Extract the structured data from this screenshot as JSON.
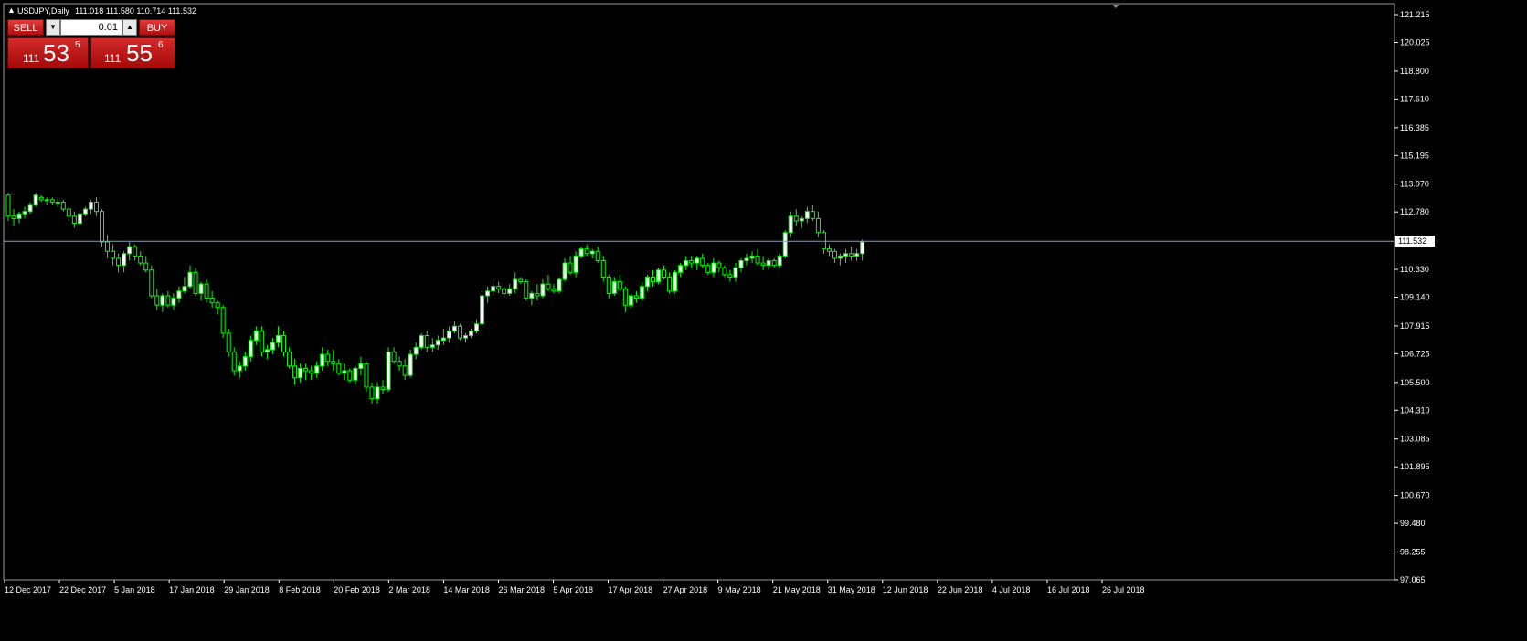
{
  "header": {
    "symbol": "USDJPY,Daily",
    "ohlc": "111.018 111.580 110.714 111.532"
  },
  "trade_panel": {
    "sell_label": "SELL",
    "buy_label": "BUY",
    "lot_value": "0.01",
    "sell_price": {
      "small": "111",
      "big": "53",
      "sup": "5"
    },
    "buy_price": {
      "small": "111",
      "big": "55",
      "sup": "6"
    }
  },
  "colors": {
    "background": "#000000",
    "axis": "#ffffff",
    "bull_fill": "#ffffff",
    "bull_wick": "#00ff00",
    "bear_fill": "#000000",
    "current_price_line": "#8aa0b8"
  },
  "chart_data": {
    "type": "candlestick",
    "ylim": [
      97.065,
      121.215
    ],
    "y_ticks": [
      "121.215",
      "120.025",
      "118.800",
      "117.610",
      "116.385",
      "115.195",
      "113.970",
      "112.780",
      "110.330",
      "109.140",
      "107.915",
      "106.725",
      "105.500",
      "104.310",
      "103.085",
      "101.895",
      "100.670",
      "99.480",
      "98.255",
      "97.065"
    ],
    "current_price": "111.532",
    "x_tick_labels": [
      "12 Dec 2017",
      "22 Dec 2017",
      "5 Jan 2018",
      "17 Jan 2018",
      "29 Jan 2018",
      "8 Feb 2018",
      "20 Feb 2018",
      "2 Mar 2018",
      "14 Mar 2018",
      "26 Mar 2018",
      "5 Apr 2018",
      "17 Apr 2018",
      "27 Apr 2018",
      "9 May 2018",
      "21 May 2018",
      "31 May 2018",
      "12 Jun 2018",
      "22 Jun 2018",
      "4 Jul 2018",
      "16 Jul 2018",
      "26 Jul 2018"
    ],
    "candles": [
      [
        113.5,
        113.6,
        112.4,
        112.6
      ],
      [
        112.6,
        112.9,
        112.2,
        112.5
      ],
      [
        112.5,
        112.8,
        112.3,
        112.7
      ],
      [
        112.7,
        113.0,
        112.5,
        112.8
      ],
      [
        112.8,
        113.2,
        112.7,
        113.1
      ],
      [
        113.1,
        113.6,
        113.0,
        113.5
      ],
      [
        113.4,
        113.5,
        113.2,
        113.3
      ],
      [
        113.3,
        113.4,
        113.1,
        113.3
      ],
      [
        113.3,
        113.4,
        113.1,
        113.2
      ],
      [
        113.2,
        113.4,
        113.0,
        113.2
      ],
      [
        113.2,
        113.3,
        112.8,
        112.9
      ],
      [
        112.9,
        113.0,
        112.4,
        112.6
      ],
      [
        112.6,
        112.8,
        112.1,
        112.3
      ],
      [
        112.3,
        112.8,
        112.2,
        112.7
      ],
      [
        112.7,
        113.0,
        112.6,
        112.9
      ],
      [
        112.9,
        113.3,
        112.7,
        113.2
      ],
      [
        113.2,
        113.4,
        112.6,
        112.8
      ],
      [
        112.8,
        112.9,
        111.3,
        111.5
      ],
      [
        111.5,
        111.8,
        110.8,
        111.1
      ],
      [
        111.1,
        111.4,
        110.5,
        110.8
      ],
      [
        110.8,
        111.0,
        110.2,
        110.5
      ],
      [
        110.5,
        111.1,
        110.2,
        111.0
      ],
      [
        111.0,
        111.5,
        110.7,
        111.3
      ],
      [
        111.3,
        111.4,
        110.7,
        110.9
      ],
      [
        110.9,
        111.1,
        110.5,
        110.6
      ],
      [
        110.6,
        110.9,
        110.2,
        110.3
      ],
      [
        110.3,
        110.5,
        109.1,
        109.2
      ],
      [
        109.2,
        109.5,
        108.6,
        108.8
      ],
      [
        108.8,
        109.3,
        108.5,
        109.2
      ],
      [
        109.2,
        109.4,
        108.7,
        108.8
      ],
      [
        108.8,
        109.3,
        108.6,
        109.1
      ],
      [
        109.1,
        109.6,
        108.9,
        109.4
      ],
      [
        109.4,
        110.0,
        109.3,
        109.6
      ],
      [
        109.6,
        110.5,
        109.5,
        110.2
      ],
      [
        110.2,
        110.4,
        109.2,
        109.3
      ],
      [
        109.3,
        109.8,
        109.0,
        109.7
      ],
      [
        109.7,
        109.9,
        108.9,
        109.1
      ],
      [
        109.1,
        109.4,
        108.7,
        108.9
      ],
      [
        108.9,
        109.0,
        108.4,
        108.7
      ],
      [
        108.7,
        108.8,
        107.4,
        107.6
      ],
      [
        107.6,
        107.8,
        106.6,
        106.8
      ],
      [
        106.8,
        107.0,
        105.8,
        106.0
      ],
      [
        106.0,
        106.4,
        105.7,
        106.2
      ],
      [
        106.2,
        106.8,
        106.0,
        106.6
      ],
      [
        106.6,
        107.5,
        106.4,
        107.3
      ],
      [
        107.3,
        107.9,
        107.1,
        107.7
      ],
      [
        107.7,
        107.9,
        106.6,
        106.8
      ],
      [
        106.8,
        107.1,
        106.5,
        106.9
      ],
      [
        106.9,
        107.4,
        106.7,
        107.2
      ],
      [
        107.2,
        107.9,
        107.0,
        107.5
      ],
      [
        107.5,
        107.7,
        106.6,
        106.8
      ],
      [
        106.8,
        107.0,
        106.1,
        106.2
      ],
      [
        106.2,
        106.5,
        105.4,
        105.7
      ],
      [
        105.7,
        106.3,
        105.5,
        106.1
      ],
      [
        106.1,
        106.3,
        105.6,
        106.0
      ],
      [
        106.0,
        106.2,
        105.6,
        105.9
      ],
      [
        105.9,
        106.4,
        105.7,
        106.2
      ],
      [
        106.2,
        107.0,
        106.0,
        106.7
      ],
      [
        106.7,
        106.9,
        106.2,
        106.4
      ],
      [
        106.4,
        106.9,
        106.0,
        106.3
      ],
      [
        106.3,
        106.5,
        105.8,
        105.9
      ],
      [
        105.9,
        106.3,
        105.6,
        106.0
      ],
      [
        106.0,
        106.1,
        105.5,
        105.6
      ],
      [
        105.6,
        106.2,
        105.4,
        106.1
      ],
      [
        106.1,
        106.6,
        105.8,
        106.3
      ],
      [
        106.3,
        106.4,
        105.1,
        105.3
      ],
      [
        105.3,
        105.5,
        104.6,
        104.8
      ],
      [
        104.8,
        105.5,
        104.6,
        105.3
      ],
      [
        105.3,
        105.6,
        105.0,
        105.2
      ],
      [
        105.2,
        107.0,
        105.1,
        106.8
      ],
      [
        106.8,
        107.0,
        106.3,
        106.4
      ],
      [
        106.4,
        106.6,
        106.0,
        106.2
      ],
      [
        106.2,
        106.5,
        105.6,
        105.8
      ],
      [
        105.8,
        106.9,
        105.7,
        106.7
      ],
      [
        106.7,
        107.2,
        106.5,
        107.0
      ],
      [
        107.0,
        107.6,
        106.9,
        107.5
      ],
      [
        107.5,
        107.7,
        106.8,
        107.0
      ],
      [
        107.0,
        107.4,
        106.8,
        107.1
      ],
      [
        107.1,
        107.5,
        106.9,
        107.3
      ],
      [
        107.3,
        107.8,
        107.1,
        107.4
      ],
      [
        107.4,
        107.9,
        107.2,
        107.7
      ],
      [
        107.7,
        108.1,
        107.6,
        107.9
      ],
      [
        107.9,
        108.0,
        107.3,
        107.4
      ],
      [
        107.4,
        107.6,
        107.2,
        107.5
      ],
      [
        107.5,
        107.8,
        107.4,
        107.7
      ],
      [
        107.7,
        108.2,
        107.6,
        108.0
      ],
      [
        108.0,
        109.4,
        107.9,
        109.2
      ],
      [
        109.2,
        109.6,
        108.9,
        109.4
      ],
      [
        109.4,
        109.9,
        109.2,
        109.6
      ],
      [
        109.6,
        109.8,
        109.3,
        109.5
      ],
      [
        109.5,
        109.6,
        109.1,
        109.3
      ],
      [
        109.3,
        109.7,
        109.2,
        109.5
      ],
      [
        109.5,
        110.2,
        109.3,
        109.9
      ],
      [
        109.9,
        110.0,
        109.7,
        109.8
      ],
      [
        109.8,
        109.9,
        109.0,
        109.1
      ],
      [
        109.1,
        109.4,
        108.8,
        109.3
      ],
      [
        109.3,
        109.7,
        109.0,
        109.2
      ],
      [
        109.2,
        109.9,
        109.1,
        109.7
      ],
      [
        109.7,
        110.1,
        109.4,
        109.5
      ],
      [
        109.5,
        109.7,
        109.3,
        109.4
      ],
      [
        109.4,
        110.0,
        109.3,
        109.9
      ],
      [
        109.9,
        110.8,
        109.8,
        110.6
      ],
      [
        110.6,
        110.9,
        110.1,
        110.2
      ],
      [
        110.2,
        111.1,
        110.0,
        110.9
      ],
      [
        110.9,
        111.3,
        110.8,
        111.2
      ],
      [
        111.2,
        111.4,
        110.9,
        111.0
      ],
      [
        111.0,
        111.2,
        110.8,
        111.1
      ],
      [
        111.1,
        111.3,
        110.6,
        110.7
      ],
      [
        110.7,
        110.9,
        109.8,
        110.0
      ],
      [
        110.0,
        110.1,
        109.1,
        109.3
      ],
      [
        109.3,
        110.0,
        109.2,
        109.8
      ],
      [
        109.8,
        110.1,
        109.4,
        109.5
      ],
      [
        109.5,
        109.6,
        108.5,
        108.8
      ],
      [
        108.8,
        109.3,
        108.7,
        109.2
      ],
      [
        109.2,
        109.4,
        108.9,
        109.1
      ],
      [
        109.1,
        109.8,
        109.0,
        109.6
      ],
      [
        109.6,
        110.1,
        109.4,
        110.0
      ],
      [
        110.0,
        110.3,
        109.6,
        109.8
      ],
      [
        109.8,
        110.4,
        109.7,
        110.3
      ],
      [
        110.3,
        110.5,
        109.9,
        110.0
      ],
      [
        110.0,
        110.2,
        109.3,
        109.4
      ],
      [
        109.4,
        110.3,
        109.3,
        110.2
      ],
      [
        110.2,
        110.6,
        110.0,
        110.5
      ],
      [
        110.5,
        110.9,
        110.3,
        110.7
      ],
      [
        110.7,
        110.9,
        110.4,
        110.6
      ],
      [
        110.6,
        110.9,
        110.3,
        110.8
      ],
      [
        110.8,
        111.0,
        110.4,
        110.5
      ],
      [
        110.5,
        110.6,
        110.1,
        110.2
      ],
      [
        110.2,
        110.8,
        110.0,
        110.6
      ],
      [
        110.6,
        110.7,
        110.2,
        110.4
      ],
      [
        110.4,
        110.5,
        110.0,
        110.1
      ],
      [
        110.1,
        110.3,
        109.8,
        110.0
      ],
      [
        110.0,
        110.6,
        109.8,
        110.4
      ],
      [
        110.4,
        110.8,
        110.2,
        110.7
      ],
      [
        110.7,
        111.0,
        110.5,
        110.8
      ],
      [
        110.8,
        111.1,
        110.6,
        110.9
      ],
      [
        110.9,
        111.2,
        110.5,
        110.6
      ],
      [
        110.6,
        110.9,
        110.3,
        110.5
      ],
      [
        110.5,
        110.8,
        110.3,
        110.7
      ],
      [
        110.7,
        110.8,
        110.4,
        110.5
      ],
      [
        110.5,
        111.0,
        110.4,
        110.9
      ],
      [
        110.9,
        112.0,
        110.8,
        111.9
      ],
      [
        111.9,
        112.8,
        111.7,
        112.6
      ],
      [
        112.6,
        112.9,
        112.2,
        112.4
      ],
      [
        112.4,
        112.6,
        112.1,
        112.5
      ],
      [
        112.5,
        113.0,
        112.3,
        112.8
      ],
      [
        112.8,
        113.1,
        112.4,
        112.5
      ],
      [
        112.5,
        112.8,
        111.7,
        111.9
      ],
      [
        111.9,
        112.0,
        111.0,
        111.2
      ],
      [
        111.2,
        111.4,
        110.9,
        111.1
      ],
      [
        111.1,
        111.2,
        110.6,
        110.8
      ],
      [
        110.8,
        111.0,
        110.5,
        110.9
      ],
      [
        110.9,
        111.2,
        110.6,
        111.0
      ],
      [
        111.0,
        111.3,
        110.7,
        110.9
      ],
      [
        110.9,
        111.2,
        110.7,
        111.0
      ],
      [
        111.0,
        111.6,
        110.7,
        111.5
      ]
    ]
  }
}
